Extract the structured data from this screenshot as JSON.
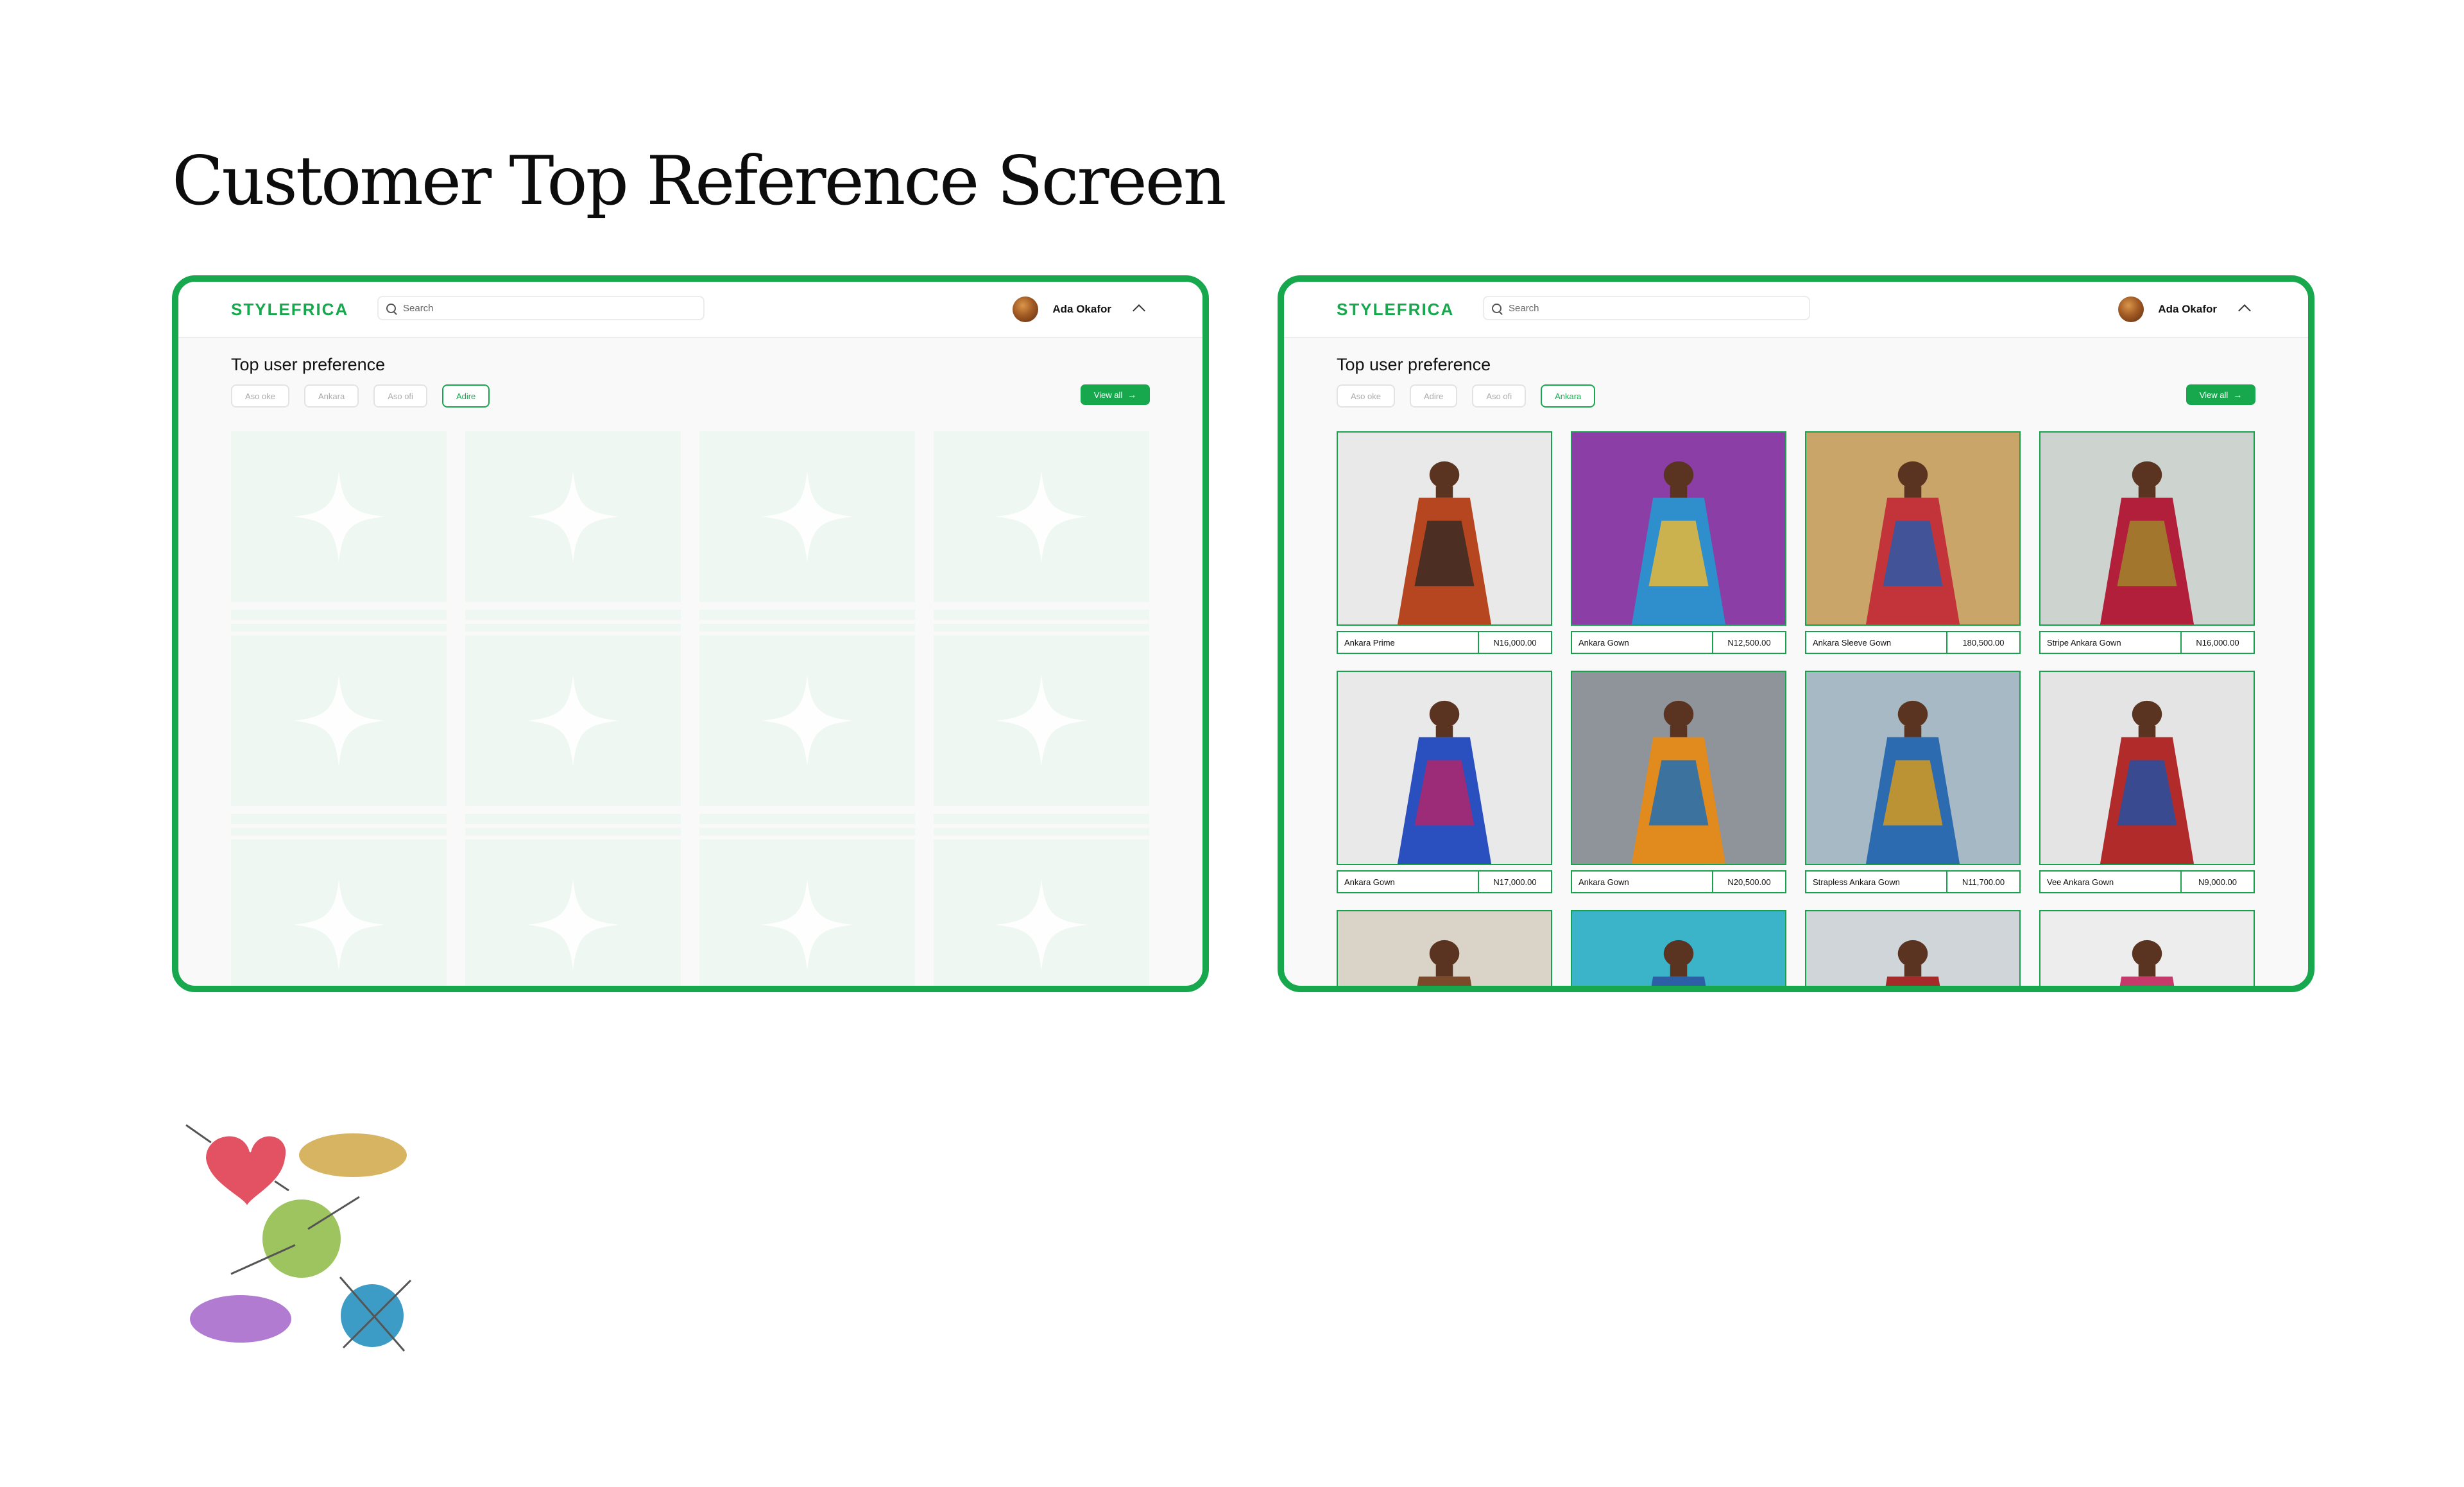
{
  "page": {
    "title": "Customer Top Reference Screen"
  },
  "colors": {
    "brand_green": "#17a84e",
    "skeleton_fill": "#eef7f1",
    "frame_background": "#f9f9f9"
  },
  "screens": [
    {
      "state": "loading",
      "brand": "STYLEFRICA",
      "search_placeholder": "Search",
      "user_name": "Ada Okafor",
      "section_title": "Top user preference",
      "chips": [
        {
          "label": "Aso oke",
          "active": false
        },
        {
          "label": "Ankara",
          "active": false
        },
        {
          "label": "Aso ofi",
          "active": false
        },
        {
          "label": "Adire",
          "active": true
        }
      ],
      "view_all_label": "View all",
      "skeleton_count": 12
    },
    {
      "state": "loaded",
      "brand": "STYLEFRICA",
      "search_placeholder": "Search",
      "user_name": "Ada Okafor",
      "section_title": "Top user preference",
      "chips": [
        {
          "label": "Aso oke",
          "active": false
        },
        {
          "label": "Adire",
          "active": false
        },
        {
          "label": "Aso ofi",
          "active": false
        },
        {
          "label": "Ankara",
          "active": true
        }
      ],
      "view_all_label": "View all",
      "products": [
        {
          "name": "Ankara Prime",
          "price": "N16,000.00",
          "colors": [
            "#e9e9e9",
            "#b5461f",
            "#3b2a24"
          ]
        },
        {
          "name": "Ankara Gown",
          "price": "N12,500.00",
          "colors": [
            "#8b3fa6",
            "#2f8fcc",
            "#e8b838"
          ]
        },
        {
          "name": "Ankara Sleeve Gown",
          "price": "180,500.00",
          "colors": [
            "#c9a56a",
            "#c2343a",
            "#2b5aa8"
          ]
        },
        {
          "name": "Stripe Ankara Gown",
          "price": "N16,000.00",
          "colors": [
            "#cdd4d0",
            "#b21f3a",
            "#a0862b"
          ]
        },
        {
          "name": "Ankara Gown",
          "price": "N17,000.00",
          "colors": [
            "#e9e9e9",
            "#2a4fbf",
            "#b0266b"
          ]
        },
        {
          "name": "Ankara Gown",
          "price": "N20,500.00",
          "colors": [
            "#8f939a",
            "#e18a1e",
            "#1f6fb5"
          ]
        },
        {
          "name": "Strapless Ankara Gown",
          "price": "N11,700.00",
          "colors": [
            "#a7b9c4",
            "#2d6bb0",
            "#d69a1f"
          ]
        },
        {
          "name": "Vee Ankara Gown",
          "price": "N9,000.00",
          "colors": [
            "#e4e4e4",
            "#b22b2b",
            "#2450a3"
          ]
        },
        {
          "name": "",
          "price": "",
          "colors": [
            "#d9d3c8",
            "#7a4a2b",
            "#2b6b37"
          ]
        },
        {
          "name": "",
          "price": "",
          "colors": [
            "#3bb3c9",
            "#2c5fa5",
            "#c7a07a"
          ]
        },
        {
          "name": "",
          "price": "",
          "colors": [
            "#d0d5da",
            "#a52a2a",
            "#3d2a1f"
          ]
        },
        {
          "name": "",
          "price": "",
          "colors": [
            "#ededed",
            "#c6396b",
            "#2e6bb8"
          ]
        }
      ]
    }
  ],
  "decoration": {
    "icon": "yarn-balls-icon",
    "yarn_colors": [
      "#e25263",
      "#d6b461",
      "#9ec45f",
      "#b27bd2",
      "#3c9cc6"
    ]
  }
}
